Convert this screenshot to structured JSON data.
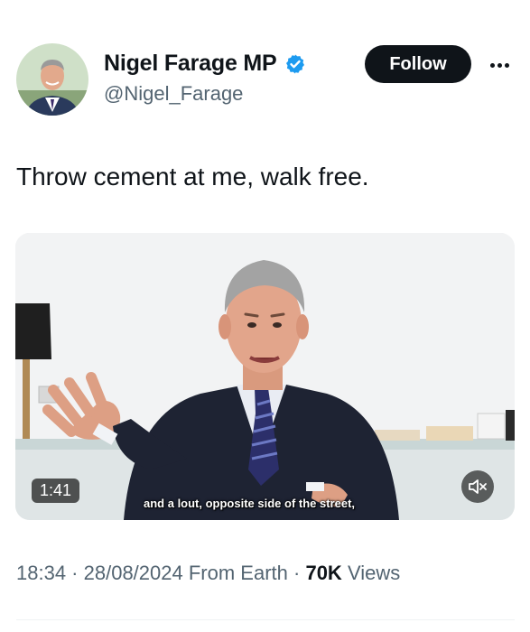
{
  "author": {
    "display_name": "Nigel Farage MP",
    "handle": "@Nigel_Farage",
    "verified": true
  },
  "actions": {
    "follow_label": "Follow"
  },
  "tweet": {
    "text": "Throw cement at me, walk free."
  },
  "media": {
    "type": "video",
    "duration": "1:41",
    "caption": "and a lout, opposite side of the street,",
    "muted": true
  },
  "meta": {
    "time": "18:34",
    "separator": " · ",
    "date": "28/08/2024",
    "source": "From Earth",
    "views_count": "70K",
    "views_label": "Views"
  },
  "colors": {
    "text_primary": "#0f1419",
    "text_secondary": "#536471",
    "verified_blue": "#1d9bf0",
    "follow_bg": "#0f1419"
  },
  "icons": {
    "verified": "verified-badge-icon",
    "more": "more-options-icon",
    "mute": "speaker-muted-icon"
  }
}
